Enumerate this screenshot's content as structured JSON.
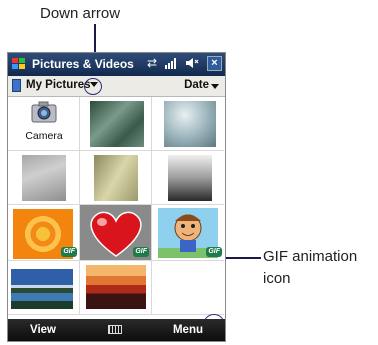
{
  "callouts": {
    "down_arrow": "Down arrow",
    "gif_icon_line1": "GIF animation",
    "gif_icon_line2": "icon"
  },
  "window": {
    "title": "Pictures & Videos",
    "status_icons": [
      "connectivity-icon",
      "signal-icon",
      "speaker-icon"
    ],
    "close_label": "×"
  },
  "toolbar": {
    "folder_label": "My Pictures",
    "sort_label": "Date"
  },
  "grid": [
    {
      "label": "Camera",
      "kind": "camera"
    },
    {
      "kind": "photo"
    },
    {
      "kind": "photo"
    },
    {
      "kind": "photo"
    },
    {
      "kind": "photo"
    },
    {
      "kind": "photo"
    },
    {
      "kind": "gif",
      "badge": "GIF"
    },
    {
      "kind": "gif",
      "badge": "GIF",
      "selected": true
    },
    {
      "kind": "gif",
      "badge": "GIF"
    },
    {
      "kind": "photo"
    },
    {
      "kind": "photo"
    },
    {
      "kind": "empty"
    }
  ],
  "softkeys": {
    "left": "View",
    "right": "Menu"
  },
  "colors": {
    "titlebar": "#1f3a66",
    "softbar": "#1a1a1a",
    "accent": "#2b2b7a"
  }
}
